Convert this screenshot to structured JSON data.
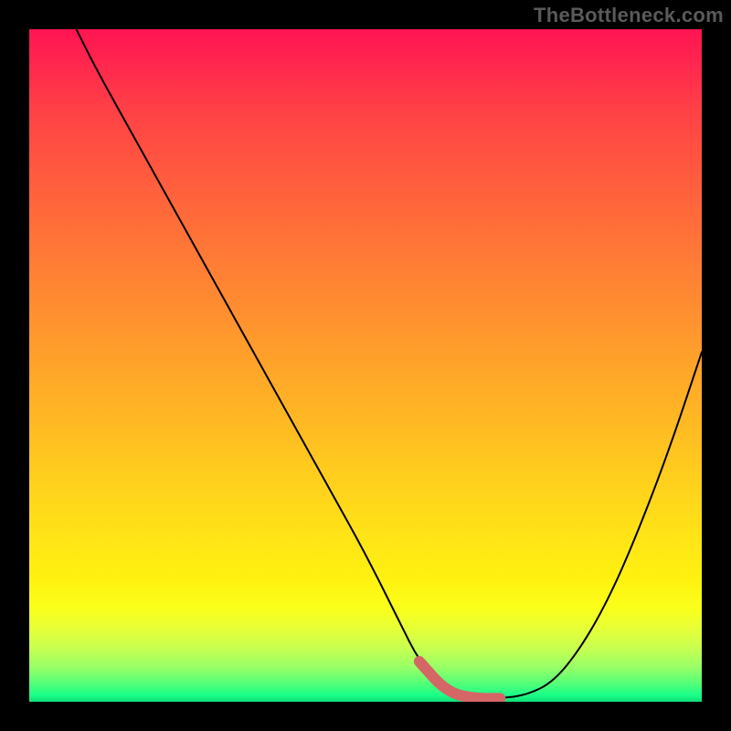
{
  "watermark": "TheBottleneck.com",
  "colors": {
    "background": "#000000",
    "curve": "#000000",
    "accent": "#d56666",
    "gradient_top": "#ff1452",
    "gradient_bottom": "#10e078"
  },
  "chart_data": {
    "type": "line",
    "title": "",
    "xlabel": "",
    "ylabel": "",
    "xlim": [
      0,
      100
    ],
    "ylim": [
      0,
      100
    ],
    "note": "No numeric axis tick labels are rendered in the image; x/y values below are estimated from pixel positions (0–100 normalized).",
    "series": [
      {
        "name": "curve",
        "x": [
          7,
          10,
          15,
          20,
          25,
          30,
          35,
          40,
          45,
          50,
          55,
          58,
          62,
          66,
          70,
          74,
          78,
          82,
          86,
          90,
          95,
          100
        ],
        "values": [
          100,
          94,
          85,
          76,
          67,
          58,
          49,
          40,
          31,
          22,
          12,
          6,
          1.5,
          0.5,
          0.5,
          1.0,
          3,
          8,
          15,
          24,
          37,
          52
        ]
      }
    ],
    "accent_region": {
      "x_start": 58,
      "x_end": 72,
      "description": "highlighted minimum segment"
    }
  }
}
